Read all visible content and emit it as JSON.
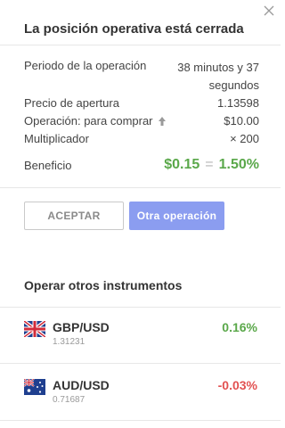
{
  "dialog": {
    "title": "La posición operativa está cerrada",
    "close_icon": "close-icon"
  },
  "details": {
    "period_label": "Periodo de la operación",
    "period_value_line1": "38 minutos y 37",
    "period_value_line2": "segundos",
    "open_price_label": "Precio de apertura",
    "open_price_value": "1.13598",
    "operation_label": "Operación: para comprar",
    "operation_icon": "arrow-up-icon",
    "operation_value": "$10.00",
    "multiplier_label": "Multiplicador",
    "multiplier_value": "× 200",
    "profit_label": "Beneficio",
    "profit_amount": "$0.15",
    "profit_eq": "=",
    "profit_percent": "1.50%"
  },
  "buttons": {
    "accept_label": "ACEPTAR",
    "other_label": "Otra operación"
  },
  "instruments": {
    "section_title": "Operar otros instrumentos",
    "items": [
      {
        "name": "GBP/USD",
        "price": "1.31231",
        "change": "0.16%",
        "change_color": "#5aa84a",
        "flag_icon": "uk-flag-icon"
      },
      {
        "name": "AUD/USD",
        "price": "0.71687",
        "change": "-0.03%",
        "change_color": "#e25151",
        "flag_icon": "australia-flag-icon"
      }
    ]
  },
  "colors": {
    "positive": "#5aa84a",
    "negative": "#e25151",
    "accent": "#8b9df0"
  }
}
